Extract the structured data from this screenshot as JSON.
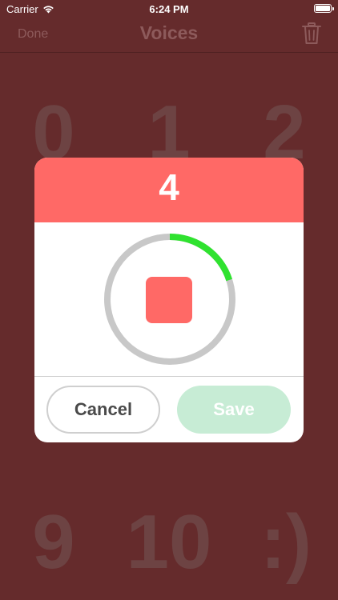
{
  "status_bar": {
    "carrier": "Carrier",
    "time": "6:24 PM"
  },
  "nav": {
    "done_label": "Done",
    "title": "Voices",
    "trash_icon": "trash-icon"
  },
  "background_digits": {
    "d0": "0",
    "d1": "1",
    "d2": "2",
    "d9": "9",
    "d10": "10",
    "smile": ":)"
  },
  "dialog": {
    "count": "4",
    "progress_fraction": 0.2,
    "stop_icon": "stop-icon",
    "cancel_label": "Cancel",
    "save_label": "Save"
  },
  "colors": {
    "background": "#652b2c",
    "accent": "#ff6966",
    "progress": "#2fe22f",
    "ring_track": "#c8c8c8",
    "save_disabled": "#c7ecd5"
  }
}
